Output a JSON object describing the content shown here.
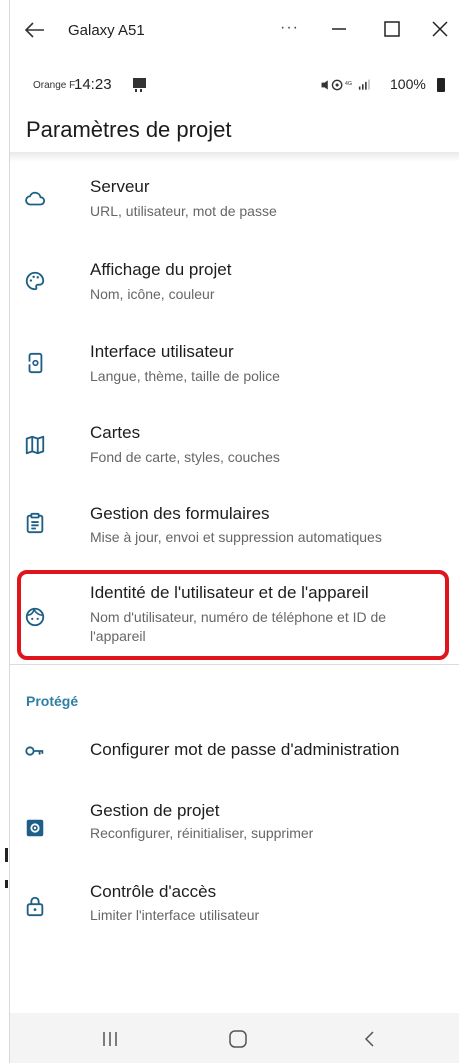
{
  "window": {
    "title": "Galaxy A51",
    "more_label": "···"
  },
  "status_bar": {
    "carrier": "Orange F",
    "time": "14:23",
    "battery": "100%"
  },
  "page": {
    "title": "Paramètres de projet"
  },
  "items": [
    {
      "icon": "cloud-icon",
      "title": "Serveur",
      "subtitle": "URL, utilisateur, mot de passe"
    },
    {
      "icon": "palette-icon",
      "title": "Affichage du projet",
      "subtitle": "Nom, icône, couleur"
    },
    {
      "icon": "phone-settings-icon",
      "title": "Interface utilisateur",
      "subtitle": "Langue, thème, taille de police"
    },
    {
      "icon": "map-icon",
      "title": "Cartes",
      "subtitle": "Fond de carte, styles, couches"
    },
    {
      "icon": "clipboard-icon",
      "title": "Gestion des formulaires",
      "subtitle": "Mise à jour, envoi et suppression automatiques"
    },
    {
      "icon": "face-icon",
      "title": "Identité de l'utilisateur et de l'appareil",
      "subtitle": "Nom d'utilisateur, numéro de téléphone et ID de l'appareil"
    }
  ],
  "protected_section": {
    "header": "Protégé",
    "items": [
      {
        "icon": "key-icon",
        "title": "Configurer mot de passe d'administration"
      },
      {
        "icon": "settings-box-icon",
        "title": "Gestion de projet",
        "subtitle": "Reconfigurer, réinitialiser, supprimer"
      },
      {
        "icon": "lock-icon",
        "title": "Contrôle d'accès",
        "subtitle": "Limiter l'interface utilisateur"
      }
    ]
  },
  "colors": {
    "accent": "#2f7fa3",
    "icon": "#1e5f86",
    "highlight": "#e0141c"
  }
}
